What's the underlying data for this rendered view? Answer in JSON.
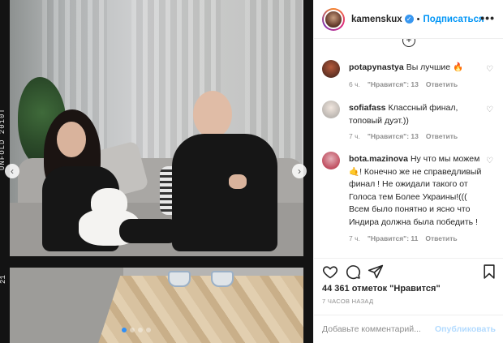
{
  "post": {
    "photo": {
      "film_label": "UNFOLD 2010T",
      "frame_number": "21"
    }
  },
  "header": {
    "username": "kamenskux",
    "separator": "•",
    "follow_label": "Подписаться",
    "more_label": "•••"
  },
  "comments": [
    {
      "username": "potapynastya",
      "text": "Вы лучшие 🔥",
      "time": "6 ч.",
      "likes": "\"Нравится\": 13",
      "reply": "Ответить"
    },
    {
      "username": "sofiafass",
      "text": "Классный финал, топовый дуэт.))",
      "time": "7 ч.",
      "likes": "\"Нравится\": 13",
      "reply": "Ответить"
    },
    {
      "username": "bota.mazinova",
      "text": "Ну что мы можем 🤙! Конечно же не справедливый финал ! Не ожидали такого от Голоса тем Более Украины!((( Всем было понятно и ясно что Индира должна была победить !",
      "time": "7 ч.",
      "likes": "\"Нравится\": 11",
      "reply": "Ответить"
    }
  ],
  "actions": {
    "likes_text": "44 361 отметок \"Нравится\"",
    "time_ago": "7 ЧАСОВ НАЗАД"
  },
  "add_comment": {
    "placeholder": "Добавьте комментарий...",
    "publish_label": "Опубликовать"
  },
  "colors": {
    "link_blue": "#0095f6",
    "verified_blue": "#3897f0",
    "muted": "#8e8e8e"
  }
}
